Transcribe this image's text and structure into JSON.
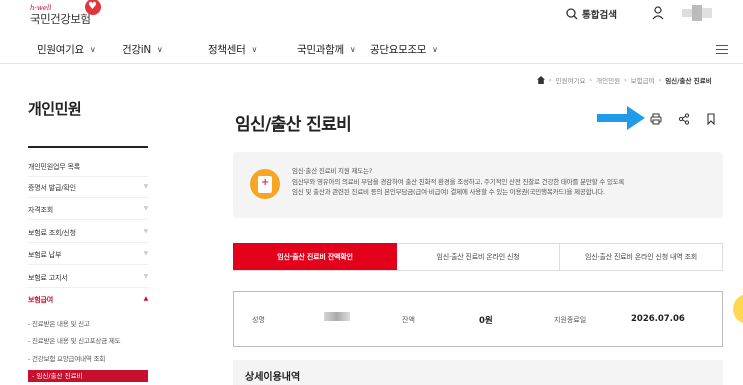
{
  "header": {
    "logo_tagline": "h-well",
    "logo_name": "국민건강보험",
    "search_label": "통합검색"
  },
  "nav": {
    "items": [
      {
        "label": "민원여기요"
      },
      {
        "label": "건강iN"
      },
      {
        "label": "정책센터"
      },
      {
        "label": "국민과함께"
      },
      {
        "label": "공단요모조모"
      }
    ]
  },
  "breadcrumb": [
    "민원여기요",
    "개인민원",
    "보험급여",
    "임신/출산 진료비"
  ],
  "sidebar": {
    "title": "개인민원",
    "items": [
      {
        "label": "개인민원업무 목록"
      },
      {
        "label": "증명서 발급/확인"
      },
      {
        "label": "자격조회"
      },
      {
        "label": "보험료 조회/신청"
      },
      {
        "label": "보험료 납부"
      },
      {
        "label": "보험료 고지서"
      },
      {
        "label": "보험급여"
      }
    ],
    "subitems": [
      {
        "label": "진료받은 내용 및 신고"
      },
      {
        "label": "진료받은 내용 및 신고포상금 제도"
      },
      {
        "label": "건강보험 요양급여내역 조회"
      },
      {
        "label": "임신/출산 진료비"
      }
    ]
  },
  "main": {
    "title": "임신/출산 진료비",
    "info": {
      "line1": "임신·출산 진료비 지원 제도는?",
      "line2": "임산부와 영유아의 의료비 부담을 경감하여 출산 친화적 환경을 조성하고, 주기적인 산전 진찰로 건강한 태아를 분만할 수 있도록",
      "line3": "임신 및 출산과 관련된 진료비 등의 본인부담금(급여·비급여) 결제에 사용할 수 있는 이용권(국민행복카드)을 제공합니다."
    },
    "tabs": [
      {
        "label": "임신·출산 진료비 잔액확인",
        "active": true
      },
      {
        "label": "임신·출산 진료비 온라인 신청",
        "active": false
      },
      {
        "label": "임신·출산 진료비 온라인 신청 내역 조회",
        "active": false
      }
    ],
    "result": {
      "name_label": "성명",
      "balance_label": "잔액",
      "balance_value": "0원",
      "end_label": "지원종료일",
      "end_value": "2026.07.06"
    },
    "detail_title": "상세이용내역"
  },
  "colors": {
    "brand_red": "#e2001a",
    "arrow_blue": "#1e9be9",
    "icon_orange": "#f6a623"
  }
}
